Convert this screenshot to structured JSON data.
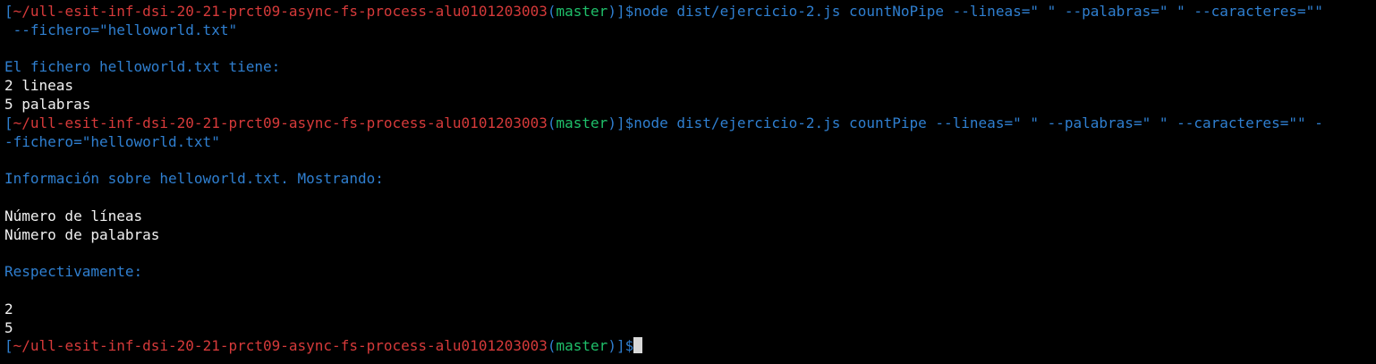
{
  "colors": {
    "background": "#000000",
    "prompt_bracket": "#2f7fd0",
    "prompt_path": "#d63a3a",
    "branch": "#1fbf6a",
    "info_text": "#2f7fd0",
    "output_text": "#f2f2f2"
  },
  "prompt": {
    "open_bracket": "[",
    "path": "~/ull-esit-inf-dsi-20-21-prct09-async-fs-process-alu0101203003",
    "branch_open": "(",
    "branch": "master",
    "branch_close": ")",
    "close_bracket": "]",
    "symbol": "$"
  },
  "commands": {
    "first_line1": "node dist/ejercicio-2.js countNoPipe --lineas=\" \" --palabras=\" \" --caracteres=\"\"",
    "first_line2": " --fichero=\"helloworld.txt\"",
    "second_line1": "node dist/ejercicio-2.js countPipe --lineas=\" \" --palabras=\" \" --caracteres=\"\" -",
    "second_line2": "-fichero=\"helloworld.txt\""
  },
  "output": {
    "no_pipe_header": "El fichero helloworld.txt tiene:",
    "no_pipe_lines": "2 lineas",
    "no_pipe_words": "5 palabras",
    "pipe_header": "Información sobre helloworld.txt. Mostrando:",
    "pipe_label_lines": "Número de líneas",
    "pipe_label_words": "Número de palabras",
    "pipe_respectively": "Respectivamente:",
    "pipe_value_lines": "2",
    "pipe_value_words": "5"
  }
}
